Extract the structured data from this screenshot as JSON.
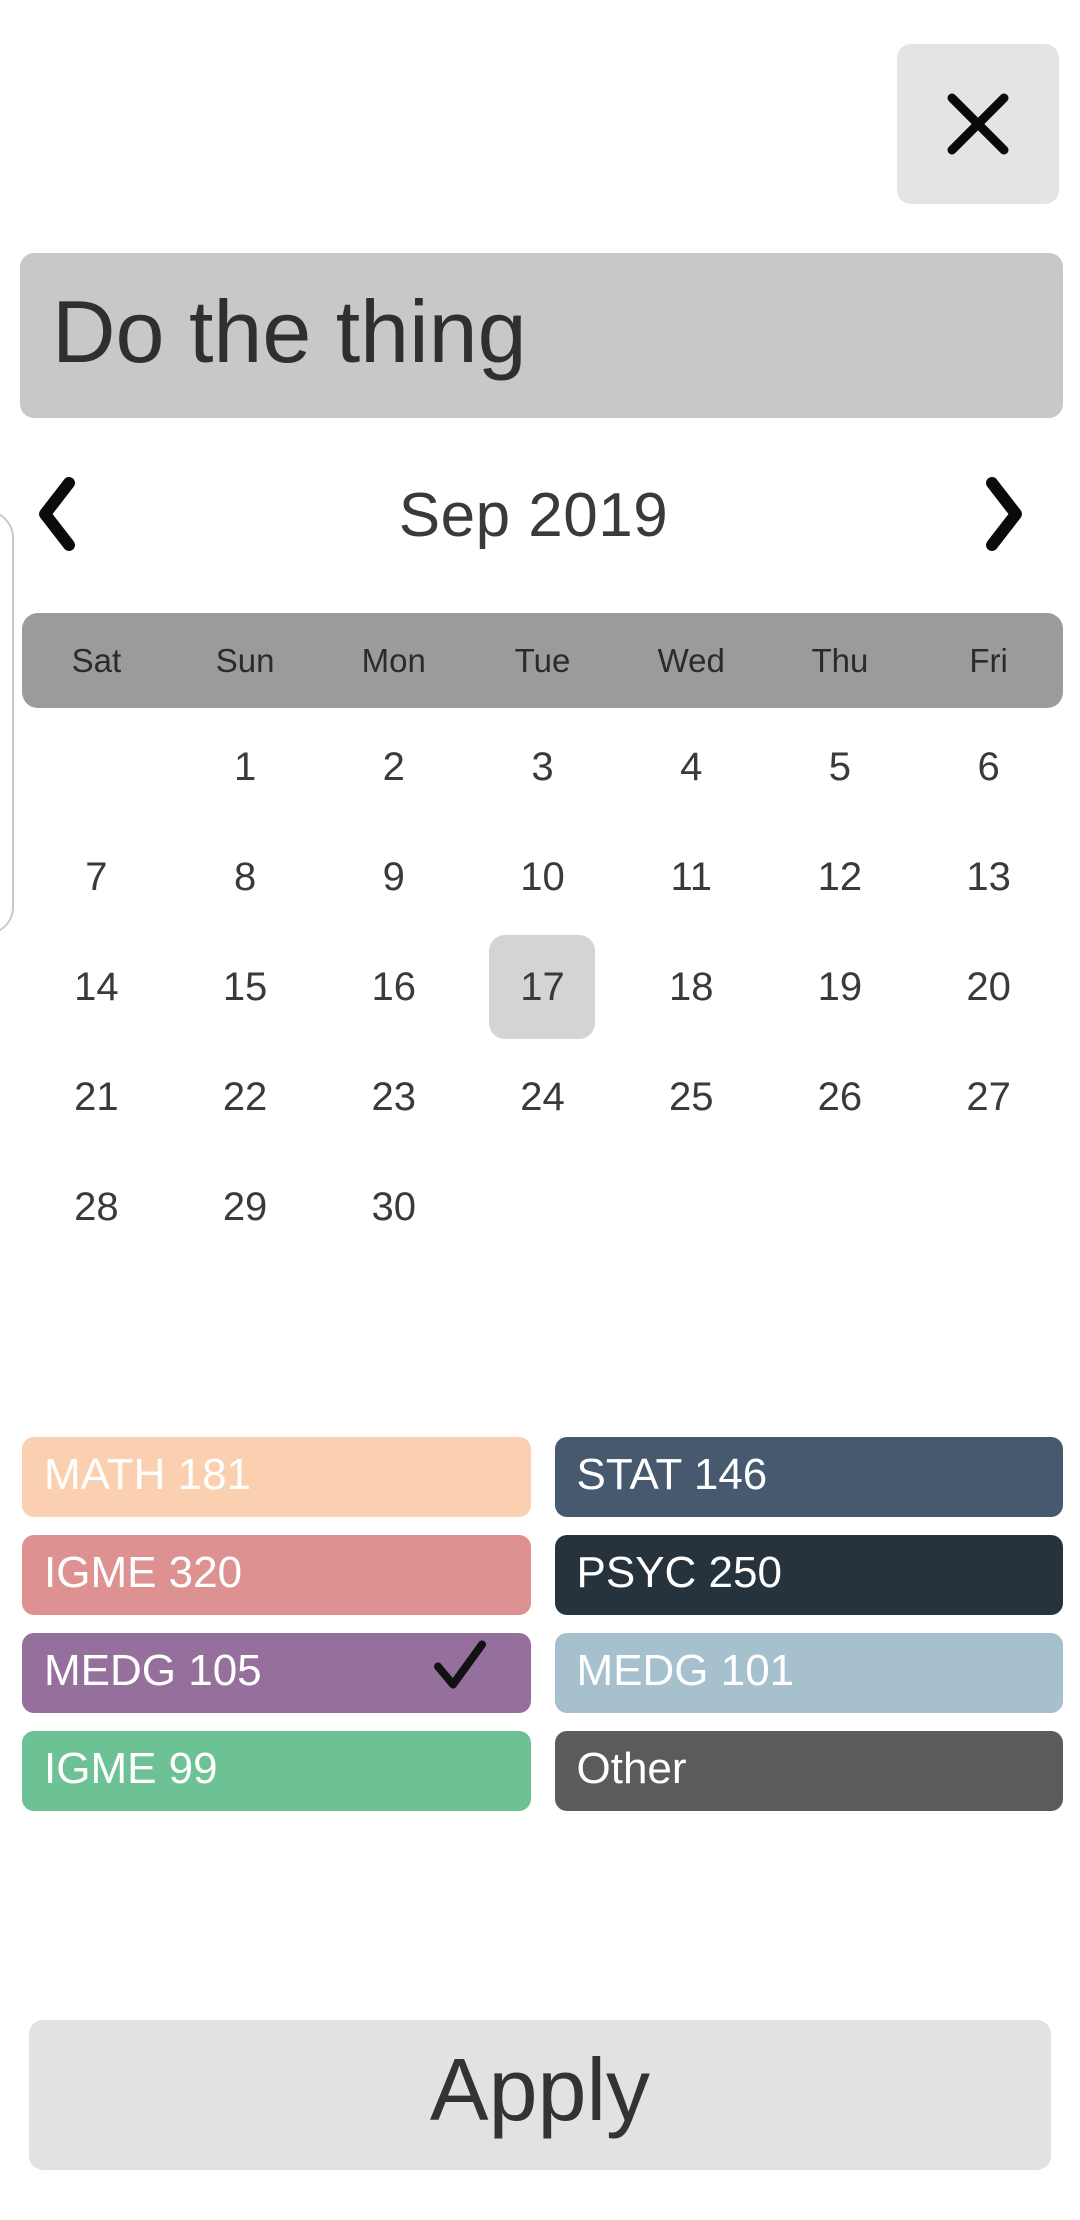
{
  "dialog": {
    "close_button": {
      "label": "✕",
      "icon": "close-icon",
      "bg": "#e4e4e4"
    },
    "title_input": {
      "value": "Do the thing",
      "placeholder": "Event name",
      "bg": "#c8c8c8"
    }
  },
  "calendar": {
    "prev_label": "‹",
    "next_label": "›",
    "prev_icon": "chevron-left-icon",
    "next_icon": "chevron-right-icon",
    "month_label": "Sep 2019",
    "weekdays": [
      "Sat",
      "Sun",
      "Mon",
      "Tue",
      "Wed",
      "Thu",
      "Fri"
    ],
    "weekday_bg": "#9b9b9b",
    "selected_day": 17,
    "selected_bg": "#d4d4d4",
    "leading_blanks": 1,
    "days": [
      1,
      2,
      3,
      4,
      5,
      6,
      7,
      8,
      9,
      10,
      11,
      12,
      13,
      14,
      15,
      16,
      17,
      18,
      19,
      20,
      21,
      22,
      23,
      24,
      25,
      26,
      27,
      28,
      29,
      30
    ]
  },
  "courses": [
    {
      "label": "MATH 181",
      "color": "#fbd0b0",
      "selected": false
    },
    {
      "label": "STAT 146",
      "color": "#46596e",
      "selected": false
    },
    {
      "label": "IGME 320",
      "color": "#dd9291",
      "selected": false
    },
    {
      "label": "PSYC 250",
      "color": "#27333c",
      "selected": false
    },
    {
      "label": "MEDG 105",
      "color": "#96709c",
      "selected": true
    },
    {
      "label": "MEDG 101",
      "color": "#a6c0cd",
      "selected": false
    },
    {
      "label": "IGME 99",
      "color": "#6cc295",
      "selected": false
    },
    {
      "label": "Other",
      "color": "#5b5b5b",
      "selected": false
    }
  ],
  "footer": {
    "apply_label": "Apply",
    "apply_bg": "#e2e2e2"
  }
}
